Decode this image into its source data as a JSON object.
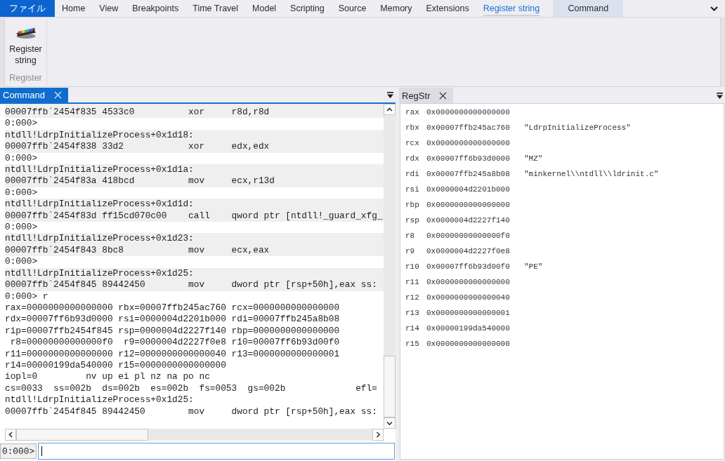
{
  "menu_tabs": [
    {
      "kind": "file",
      "label": "ファイル",
      "selected": false
    },
    {
      "kind": "tab",
      "label": "Home",
      "selected": false
    },
    {
      "kind": "tab",
      "label": "View",
      "selected": false
    },
    {
      "kind": "tab",
      "label": "Breakpoints",
      "selected": false
    },
    {
      "kind": "tab",
      "label": "Time Travel",
      "selected": false
    },
    {
      "kind": "tab",
      "label": "Model",
      "selected": false
    },
    {
      "kind": "tab",
      "label": "Scripting",
      "selected": false
    },
    {
      "kind": "tab",
      "label": "Source",
      "selected": false
    },
    {
      "kind": "tab",
      "label": "Memory",
      "selected": false
    },
    {
      "kind": "tab",
      "label": "Extensions",
      "selected": false
    },
    {
      "kind": "tab",
      "label": "Register string",
      "selected": true
    },
    {
      "kind": "contextual",
      "label": "Command",
      "selected": false
    }
  ],
  "ribbon": {
    "groups": [
      {
        "label": "Register",
        "buttons": [
          {
            "label": "Register string"
          }
        ]
      }
    ]
  },
  "command_pane": {
    "tab": {
      "label": "Command",
      "selected": true
    },
    "output": [
      {
        "shaded": true,
        "lines": [
          "00007ffb`2454f835 4533c0          xor     r8d,r8d"
        ]
      },
      {
        "shaded": false,
        "lines": [
          "0:000>"
        ]
      },
      {
        "shaded": true,
        "lines": [
          "ntdll!LdrpInitializeProcess+0x1d18:",
          "00007ffb`2454f838 33d2            xor     edx,edx"
        ]
      },
      {
        "shaded": false,
        "lines": [
          "0:000>"
        ]
      },
      {
        "shaded": true,
        "lines": [
          "ntdll!LdrpInitializeProcess+0x1d1a:",
          "00007ffb`2454f83a 418bcd          mov     ecx,r13d"
        ]
      },
      {
        "shaded": false,
        "lines": [
          "0:000>"
        ]
      },
      {
        "shaded": true,
        "lines": [
          "ntdll!LdrpInitializeProcess+0x1d1d:",
          "00007ffb`2454f83d ff15cd070c00    call    qword ptr [ntdll!_guard_xfg_"
        ]
      },
      {
        "shaded": false,
        "lines": [
          "0:000>"
        ]
      },
      {
        "shaded": true,
        "lines": [
          "ntdll!LdrpInitializeProcess+0x1d23:",
          "00007ffb`2454f843 8bc8            mov     ecx,eax"
        ]
      },
      {
        "shaded": false,
        "lines": [
          "0:000>"
        ]
      },
      {
        "shaded": true,
        "lines": [
          "ntdll!LdrpInitializeProcess+0x1d25:",
          "00007ffb`2454f845 89442450        mov     dword ptr [rsp+50h],eax ss:"
        ]
      },
      {
        "shaded": false,
        "lines": [
          "0:000> r",
          "rax=0000000000000000 rbx=00007ffb245ac760 rcx=0000000000000000",
          "rdx=00007ff6b93d0000 rsi=0000004d2201b000 rdi=00007ffb245a8b08",
          "rip=00007ffb2454f845 rsp=0000004d2227f140 rbp=0000000000000000",
          " r8=00000000000000f0  r9=0000004d2227f0e8 r10=00007ff6b93d00f0",
          "r11=0000000000000000 r12=0000000000000040 r13=0000000000000001",
          "r14=00000199da540000 r15=0000000000000000",
          "iopl=0         nv up ei pl nz na po nc",
          "cs=0033  ss=002b  ds=002b  es=002b  fs=0053  gs=002b             efl=",
          "ntdll!LdrpInitializeProcess+0x1d25:",
          "00007ffb`2454f845 89442450        mov     dword ptr [rsp+50h],eax ss:"
        ]
      }
    ],
    "prompt": "0:000>"
  },
  "regstr_pane": {
    "tab": {
      "label": "RegStr",
      "selected": false
    },
    "registers": [
      {
        "name": "rax",
        "value": "0x0000000000000000"
      },
      {
        "name": "rbx",
        "value": "0x00007ffb245ac760",
        "string": "\"LdrpInitializeProcess\""
      },
      {
        "name": "rcx",
        "value": "0x0000000000000000"
      },
      {
        "name": "rdx",
        "value": "0x00007ff6b93d0000",
        "string": "\"MZ\""
      },
      {
        "name": "rdi",
        "value": "0x00007ffb245a8b08",
        "string": "\"minkernel\\\\ntdll\\\\ldrinit.c\""
      },
      {
        "name": "rsi",
        "value": "0x0000004d2201b000"
      },
      {
        "name": "rbp",
        "value": "0x0000000000000000"
      },
      {
        "name": "rsp",
        "value": "0x0000004d2227f140"
      },
      {
        "name": "r8",
        "value": "0x00000000000000f0"
      },
      {
        "name": "r9",
        "value": "0x0000004d2227f0e8"
      },
      {
        "name": "r10",
        "value": "0x00007ff6b93d00f0",
        "string": "\"PE\""
      },
      {
        "name": "r11",
        "value": "0x0000000000000000"
      },
      {
        "name": "r12",
        "value": "0x0000000000000040"
      },
      {
        "name": "r13",
        "value": "0x0000000000000001"
      },
      {
        "name": "r14",
        "value": "0x00000199da540000"
      },
      {
        "name": "r15",
        "value": "0x0000000000000000"
      }
    ]
  }
}
